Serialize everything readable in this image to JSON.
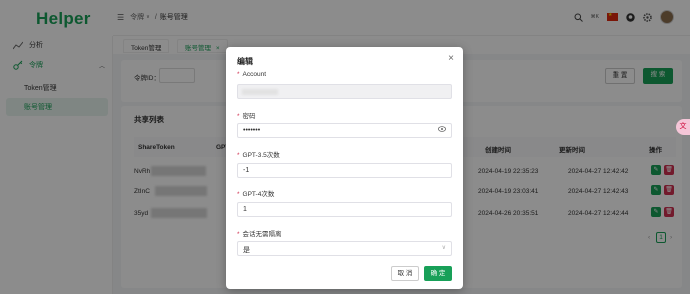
{
  "app": {
    "logo": "Helper"
  },
  "sidebar": {
    "items": [
      {
        "label": "分析",
        "icon": "chart-icon"
      },
      {
        "label": "令牌",
        "icon": "key-icon"
      },
      {
        "label": "Token管理"
      },
      {
        "label": "账号管理"
      }
    ]
  },
  "topbar": {
    "breadcrumb_parent": "令牌",
    "breadcrumb_sep": "/",
    "breadcrumb_current": "账号管理",
    "kbd_hint": "⌘K"
  },
  "tabs": [
    {
      "label": "Token管理"
    },
    {
      "label": "账号管理"
    }
  ],
  "filter": {
    "token_id_label": "令牌ID：",
    "reset_label": "重 置",
    "search_label": "搜 索"
  },
  "table": {
    "title": "共享列表",
    "headers": [
      "ShareToken",
      "GPT-3",
      "创建时间",
      "更新时间",
      "操作"
    ],
    "rows": [
      {
        "token": "NvRh",
        "created": "2024-04-19 22:35:23",
        "updated": "2024-04-27 12:42:42"
      },
      {
        "token": "ZtInC",
        "created": "2024-04-19 23:03:41",
        "updated": "2024-04-27 12:42:43"
      },
      {
        "token": "35yd",
        "created": "2024-04-26 20:35:51",
        "updated": "2024-04-27 12:42:44"
      }
    ],
    "page": "1"
  },
  "modal": {
    "title": "编辑",
    "fields": [
      {
        "label": "Account",
        "value": ""
      },
      {
        "label": "密码",
        "value": "•••••••"
      },
      {
        "label": "GPT-3.5次数",
        "value": "-1"
      },
      {
        "label": "GPT-4次数",
        "value": "1"
      },
      {
        "label": "会话无需隔离",
        "value": "是"
      }
    ],
    "cancel_label": "取 消",
    "confirm_label": "确 定"
  },
  "colors": {
    "accent": "#18a058",
    "danger": "#d03050"
  }
}
